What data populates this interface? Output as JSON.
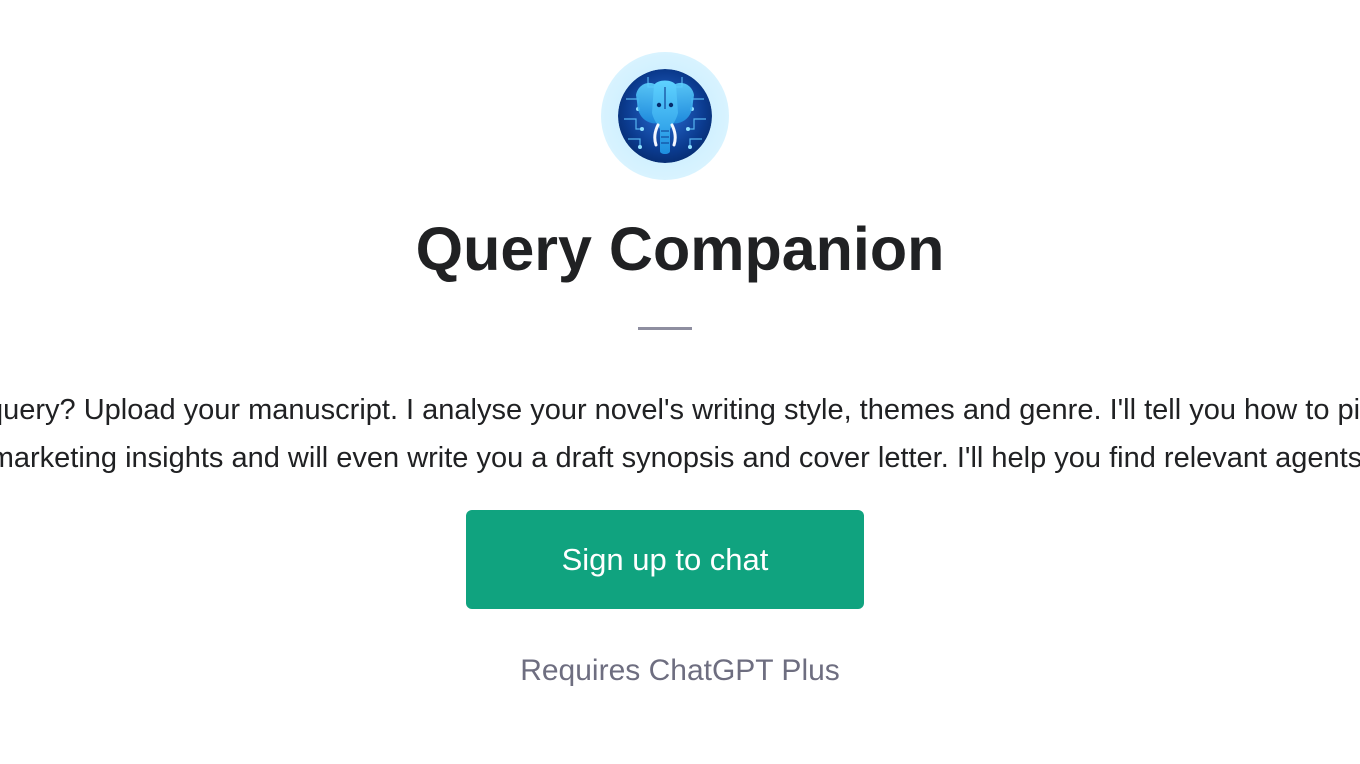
{
  "gpt": {
    "logo_icon": "elephant-circuit-logo-icon",
    "title": "Query Companion",
    "description": "Writing a query? Upload your manuscript. I analyse your novel's writing style, themes and genre. I'll tell you how to pitch it, offer marketing insights and will even write you a draft synopsis and cover letter. I'll help you find relevant agents."
  },
  "cta": {
    "label": "Sign up to chat"
  },
  "requirement": {
    "text": "Requires ChatGPT Plus"
  },
  "colors": {
    "accent": "#10a37f",
    "title": "#202123",
    "muted": "#6e6e80",
    "divider": "#8e8ea0"
  }
}
